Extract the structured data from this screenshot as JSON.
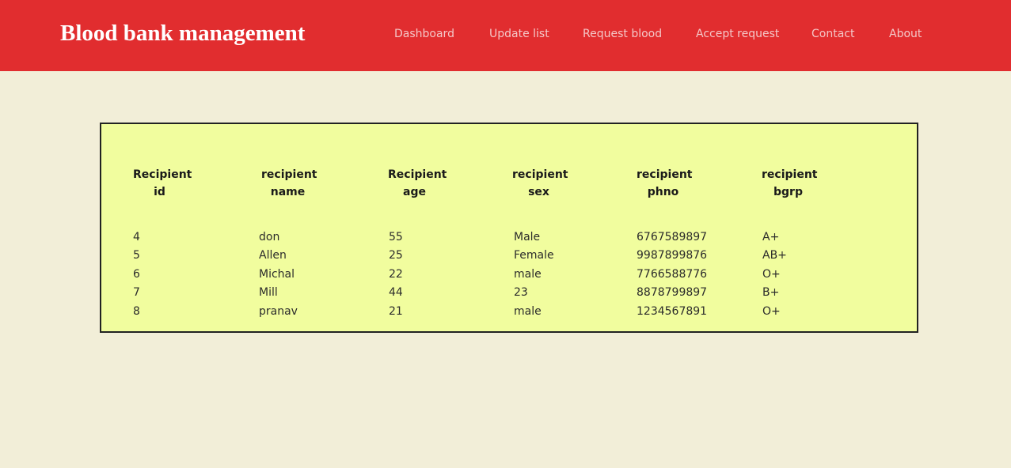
{
  "header": {
    "brand": "Blood bank management",
    "nav": [
      "Dashboard",
      "Update list",
      "Request blood",
      "Accept request",
      "Contact",
      "About"
    ]
  },
  "table": {
    "headers": [
      [
        "Recipient",
        "id"
      ],
      [
        "recipient",
        "name"
      ],
      [
        "Recipient",
        "age"
      ],
      [
        "recipient",
        "sex"
      ],
      [
        "recipient",
        "phno"
      ],
      [
        "recipient",
        "bgrp"
      ]
    ],
    "rows": [
      [
        "4",
        "don",
        "55",
        "Male",
        "6767589897",
        "A+"
      ],
      [
        "5",
        "Allen",
        "25",
        "Female",
        "9987899876",
        "AB+"
      ],
      [
        "6",
        "Michal",
        "22",
        "male",
        "7766588776",
        "O+"
      ],
      [
        "7",
        "Mill",
        "44",
        "23",
        "8878799897",
        "B+"
      ],
      [
        "8",
        "pranav",
        "21",
        "male",
        "1234567891",
        "O+"
      ]
    ]
  },
  "colors": {
    "header_bg": "#e12d2f",
    "page_bg": "#f2eed8",
    "panel_bg": "#f1fd9e",
    "panel_border": "#222222"
  }
}
